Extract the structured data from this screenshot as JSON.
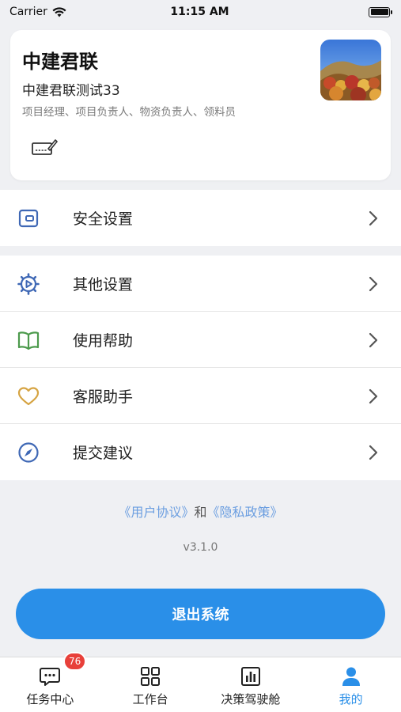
{
  "status_bar": {
    "carrier": "Carrier",
    "time": "11:15 AM"
  },
  "profile": {
    "company": "中建君联",
    "username": "中建君联测试33",
    "roles": "项目经理、项目负责人、物资负责人、领料员"
  },
  "menu": {
    "security": {
      "label": "安全设置",
      "icon": "wallet-icon",
      "color": "#3f68b5"
    },
    "other": {
      "label": "其他设置",
      "icon": "gear-icon",
      "color": "#3f68b5"
    },
    "help": {
      "label": "使用帮助",
      "icon": "book-icon",
      "color": "#4c9a4c"
    },
    "service": {
      "label": "客服助手",
      "icon": "heart-icon",
      "color": "#d6a443"
    },
    "feedback": {
      "label": "提交建议",
      "icon": "compass-icon",
      "color": "#3f68b5"
    }
  },
  "agreement": {
    "user_agreement": "《用户协议》",
    "and": "和",
    "privacy_policy": "《隐私政策》"
  },
  "version": "v3.1.0",
  "logout_label": "退出系统",
  "tabs": [
    {
      "label": "任务中心",
      "badge": "76"
    },
    {
      "label": "工作台"
    },
    {
      "label": "决策驾驶舱"
    },
    {
      "label": "我的",
      "active": true
    }
  ],
  "colors": {
    "accent": "#2a8fe8",
    "badge": "#e8403a",
    "background": "#eff0f3"
  }
}
